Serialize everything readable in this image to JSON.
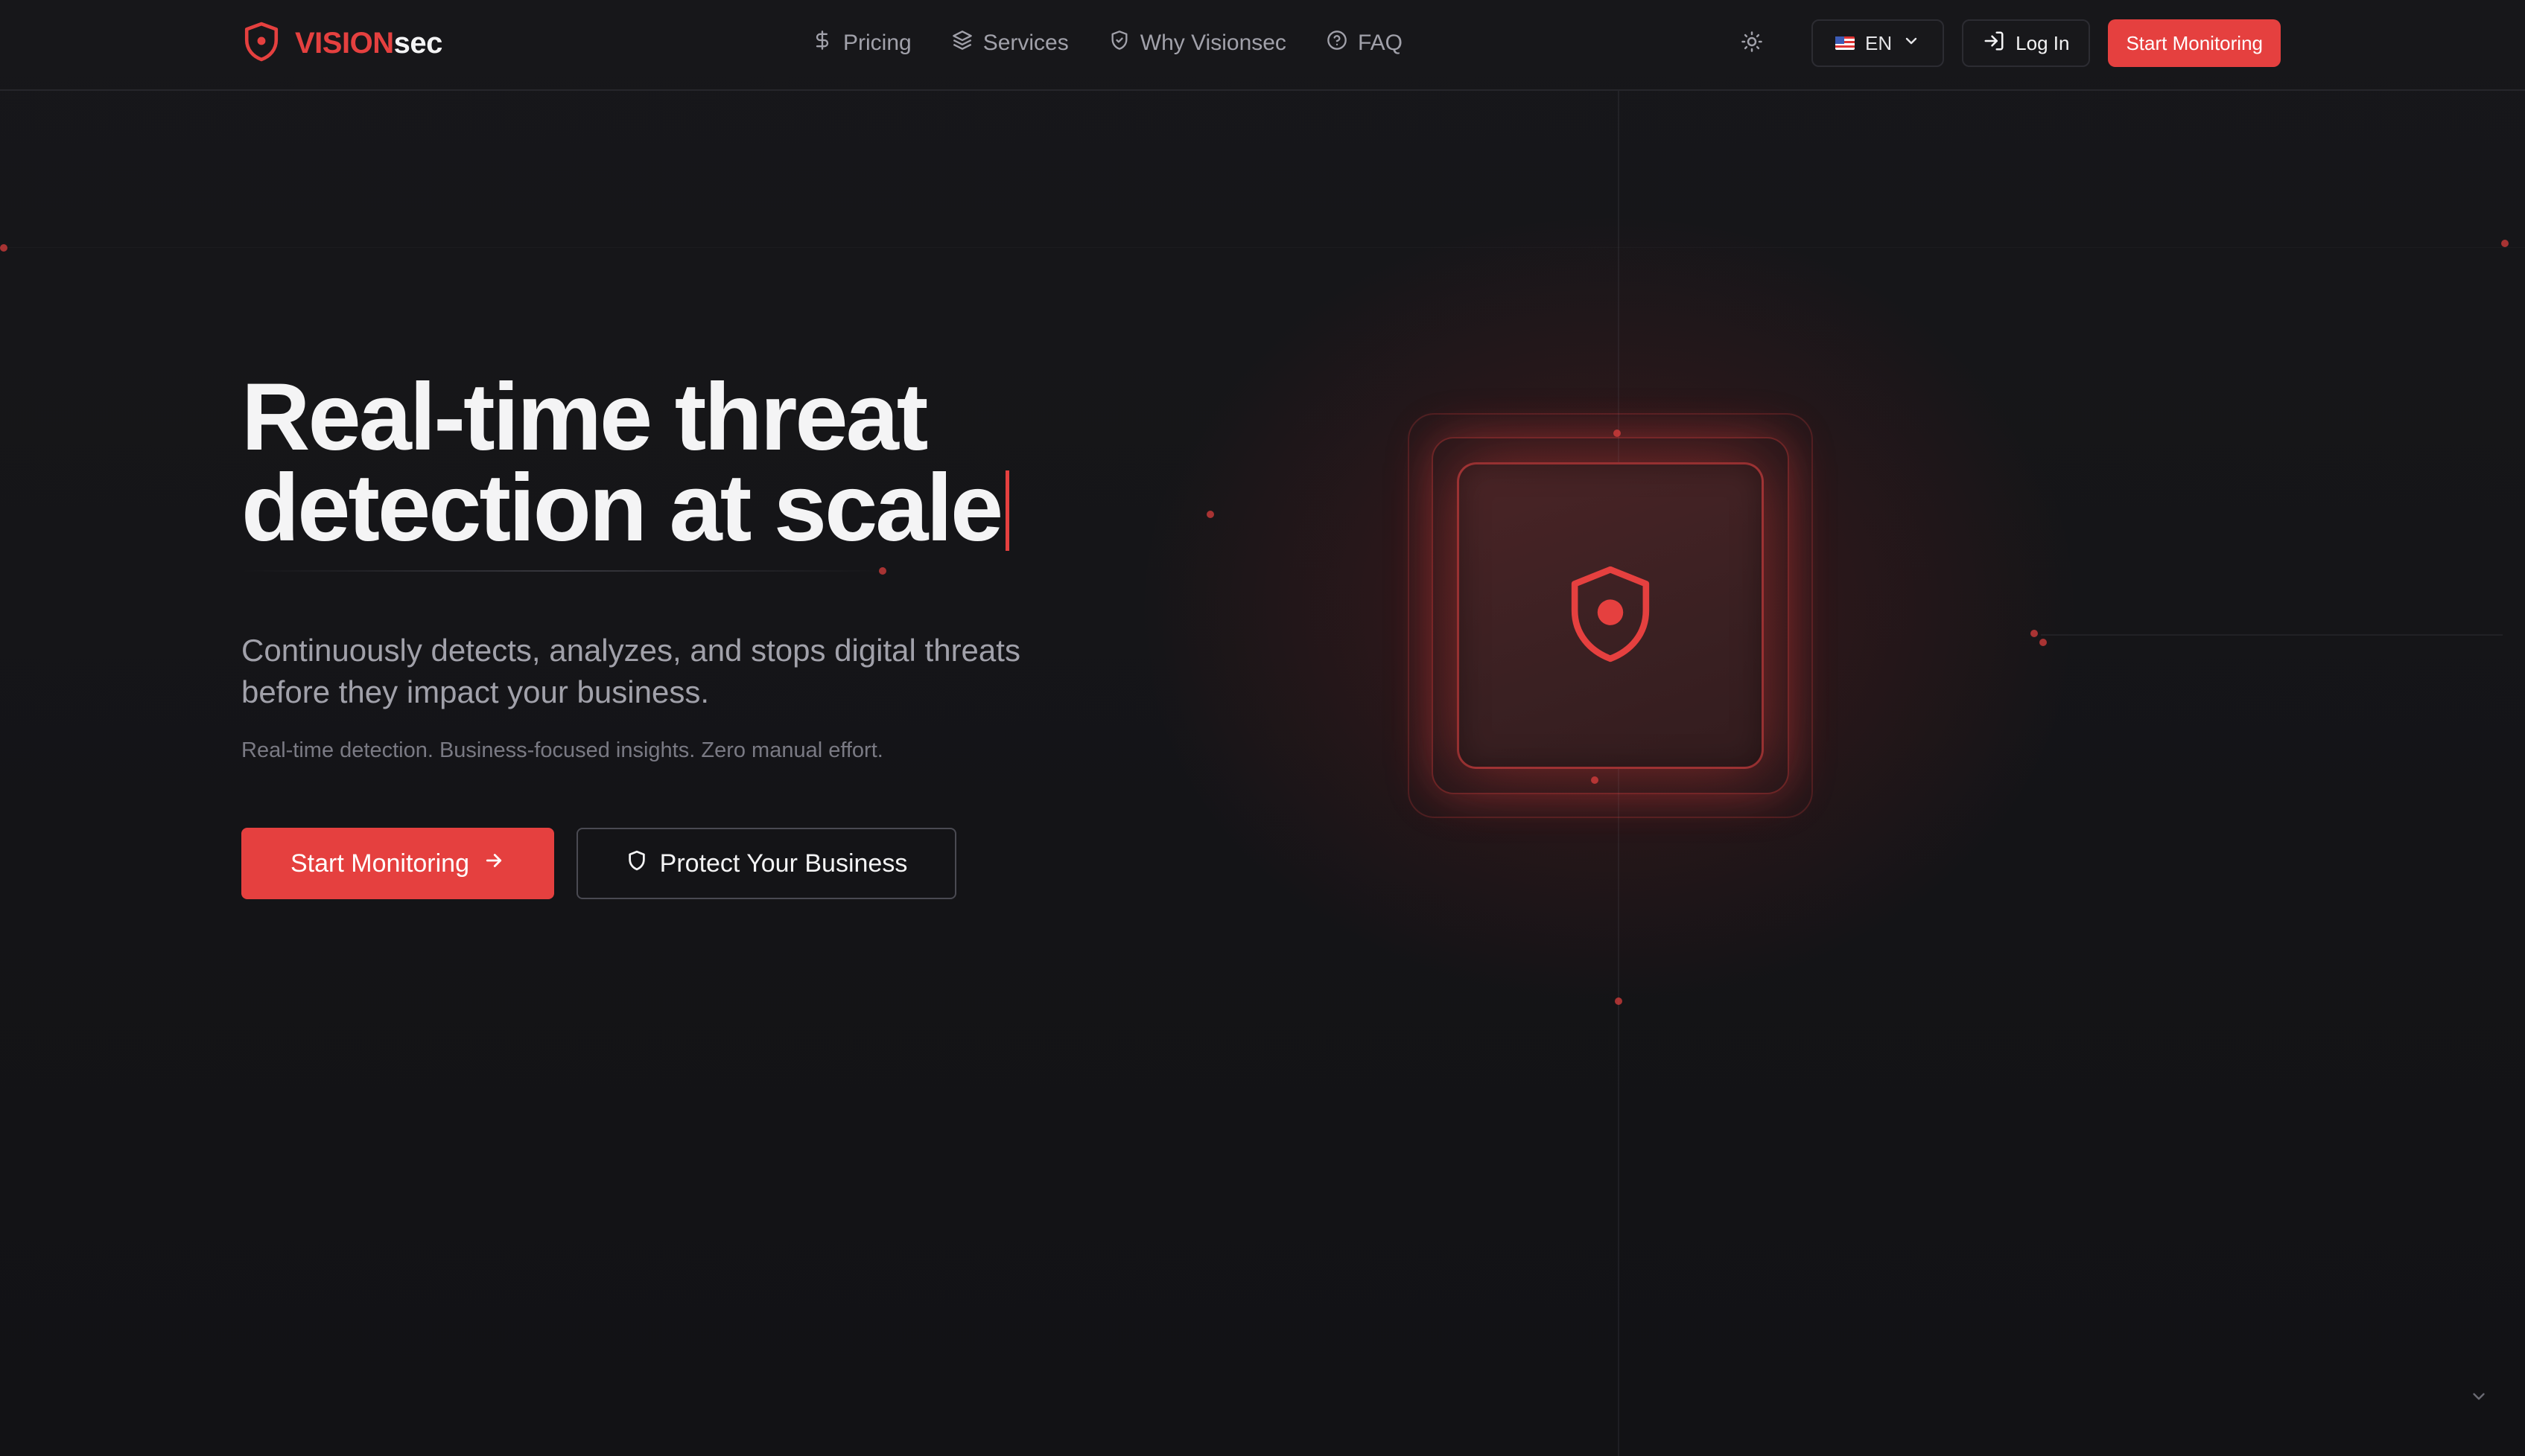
{
  "colors": {
    "accent": "#e5403f",
    "background": "#141417",
    "text": "#f4f4f5",
    "muted": "#a1a1aa"
  },
  "brand": {
    "icon": "shield-icon",
    "name_accent": "VISION",
    "name_rest": "sec"
  },
  "nav": {
    "links": [
      {
        "label": "Pricing",
        "icon": "dollar-icon"
      },
      {
        "label": "Services",
        "icon": "layers-icon"
      },
      {
        "label": "Why Visionsec",
        "icon": "shield-check-icon"
      },
      {
        "label": "FAQ",
        "icon": "help-circle-icon"
      }
    ],
    "theme_toggle_icon": "sun-icon",
    "language": {
      "label": "EN",
      "flag_icon": "us-flag-icon"
    },
    "login_label": "Log In",
    "cta_label": "Start Monitoring"
  },
  "hero": {
    "title_line1": "Real-time threat",
    "title_line2": "detection at scale",
    "subtitle": "Continuously detects, analyzes, and stops digital threats before they impact your business.",
    "note": "Real-time detection. Business-focused insights. Zero manual effort.",
    "primary_cta": "Start Monitoring",
    "secondary_cta": "Protect Your Business"
  }
}
